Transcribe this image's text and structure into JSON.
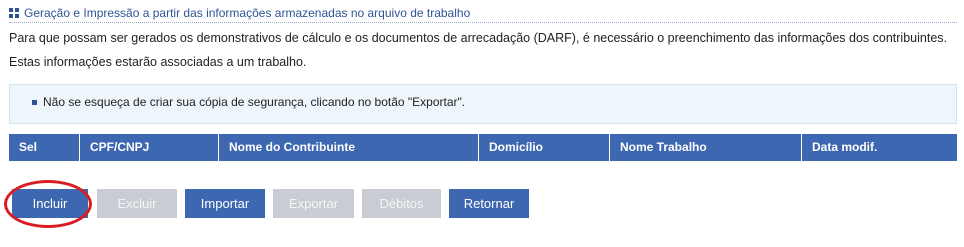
{
  "section": {
    "title": "Geração e Impressão a partir das informações armazenadas no arquivo de trabalho",
    "icon": "grid-icon"
  },
  "intro": {
    "line1": "Para que possam ser gerados os demonstrativos de cálculo e os documentos de arrecadação (DARF), é necessário o preenchimento das informações dos contribuintes.",
    "line2": "Estas informações estarão associadas a um trabalho."
  },
  "notice": {
    "text": "Não se esqueça de criar sua cópia de segurança, clicando no botão \"Exportar\"."
  },
  "table": {
    "columns": [
      "Sel",
      "CPF/CNPJ",
      "Nome do Contribuinte",
      "Domicílio",
      "Nome Trabalho",
      "Data modif."
    ],
    "rows": []
  },
  "buttons": {
    "incluir": "Incluir",
    "excluir": "Excluir",
    "importar": "Importar",
    "exportar": "Exportar",
    "debitos": "Débitos",
    "retornar": "Retornar"
  },
  "colors": {
    "primary": "#3e67b1",
    "disabled": "#c9ccd2",
    "highlight": "#d81e23",
    "notice_bg": "#eef6fb"
  }
}
